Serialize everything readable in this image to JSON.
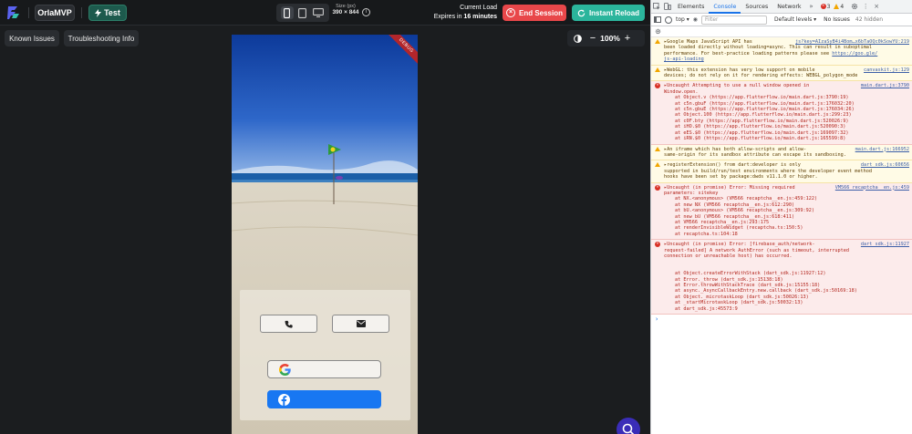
{
  "topbar": {
    "project_name": "OrlaMVP",
    "test_label": "Test",
    "size_label": "Size (px)",
    "size_value": "390 × 844",
    "load_label": "Current Load",
    "expires_prefix": "Expires in",
    "expires_value": "16 minutes",
    "end_session_label": "End Session",
    "instant_reload_label": "Instant Reload"
  },
  "toolbar": {
    "known_issues_label": "Known Issues",
    "troubleshooting_label": "Troubleshooting Info",
    "zoom_minus": "−",
    "zoom_value": "100%",
    "zoom_plus": "+"
  },
  "phone": {
    "debug_banner": "DEBUG"
  },
  "devtools": {
    "tabs": [
      "Elements",
      "Console",
      "Sources",
      "Network"
    ],
    "active_tab": "Console",
    "more_tabs": "»",
    "error_count": "3",
    "warning_count": "4",
    "context": "top",
    "filter_placeholder": "Filter",
    "levels": "Default levels",
    "issues": "No Issues",
    "hidden": "42 hidden",
    "messages": [
      {
        "level": "warn",
        "lines": [
          {
            "text": "▸Google Maps JavaScript API has",
            "src": "js?key=AIzaSyB4i4Bom…x6bTaOQc0kSowYU:219"
          },
          {
            "text": "been loaded directly without loading=async. This can result in suboptimal"
          },
          {
            "text": "performance. For best-practice loading patterns please see",
            "link": "https://goo.gle/"
          },
          {
            "link": "js-api-loading"
          }
        ],
        "stack": []
      },
      {
        "level": "warn",
        "lines": [
          {
            "text": "▸WebGL: this extension has very low support on mobile",
            "src": "canvaskit.js:129"
          },
          {
            "text": "devices; do not rely on it for rendering effects: WEBGL_polygon_mode"
          }
        ],
        "stack": []
      },
      {
        "level": "err",
        "lines": [
          {
            "text": "▸Uncaught Attempting to use a null window opened in",
            "src": "main.dart.js:3790"
          },
          {
            "text": "Window.open."
          }
        ],
        "stack": [
          "at Object.v (https://app.flutterflow.io/main.dart.js:3790:19)",
          "at c5n.gbuF (https://app.flutterflow.io/main.dart.js:176032:20)",
          "at c5n.gbuE (https://app.flutterflow.io/main.dart.js:176034:26)",
          "at Object.100 (https://app.flutterflow.io/main.dart.js:299:23)",
          "at c0F.bty (https://app.flutterflow.io/main.dart.js:520026:9)",
          "at iHO.$0 (https://app.flutterflow.io/main.dart.js:520090:3)",
          "at eES.$0 (https://app.flutterflow.io/main.dart.js:169097:32)",
          "at iRN.$0 (https://app.flutterflow.io/main.dart.js:165599:8)"
        ]
      },
      {
        "level": "warn",
        "lines": [
          {
            "text": "▸An iframe which has both allow-scripts and allow-",
            "src": "main.dart.js:166952"
          },
          {
            "text": "same-origin for its sandbox attribute can escape its sandboxing."
          }
        ],
        "stack": []
      },
      {
        "level": "warn",
        "lines": [
          {
            "text": "▸registerExtension() from dart:developer is only",
            "src": "dart_sdk.js:60656"
          },
          {
            "text": "supported in build/run/test environments where the developer event method"
          },
          {
            "text": "hooks have been set by package:dwds v11.1.0 or higher."
          }
        ],
        "stack": []
      },
      {
        "level": "err",
        "lines": [
          {
            "text": "▸Uncaught (in promise) Error: Missing required",
            "src": "VM566 recaptcha__en.js:459"
          },
          {
            "text": "parameters: sitekey"
          }
        ],
        "stack": [
          "at NX.<anonymous> (VM566 recaptcha__en.js:459:122)",
          "at new NX (VM566 recaptcha__en.js:612:290)",
          "at bU.<anonymous> (VM566 recaptcha__en.js:309:92)",
          "at new bU (VM566 recaptcha__en.js:618:411)",
          "at VM566 recaptcha__en.js:293:175",
          "at renderInvisibleWidget (recaptcha.ts:150:5)",
          "at recaptcha.ts:104:18"
        ]
      },
      {
        "level": "err",
        "lines": [
          {
            "text": "▸Uncaught (in promise) Error: [firebase_auth/network-",
            "src": "dart_sdk.js:11927"
          },
          {
            "text": "request-failed] A network AuthError (such as timeout, interrupted"
          },
          {
            "text": "connection or unreachable host) has occurred."
          },
          {
            "text": " "
          },
          {
            "text": " "
          }
        ],
        "stack": [
          "at Object.createErrorWithStack (dart_sdk.js:11927:12)",
          "at Error._throw (dart_sdk.js:15138:18)",
          "at Error.throwWithStackTrace (dart_sdk.js:15155:18)",
          "at async._AsyncCallbackEntry.new.callback (dart_sdk.js:50169:18)",
          "at Object._microtaskLoop (dart_sdk.js:50026:13)",
          "at _startMicrotaskLoop (dart_sdk.js:50032:13)",
          "at dart_sdk.js:45573:9"
        ]
      }
    ],
    "prompt": "›"
  },
  "icons": {
    "logo": "flutterflow-logo-icon",
    "phone": "phone-icon",
    "email": "envelope-icon",
    "google": "google-icon",
    "facebook": "facebook-icon",
    "chat": "chat-icon"
  },
  "colors": {
    "accent_teal": "#2bb59c",
    "end_red": "#e8474a",
    "facebook_blue": "#1877f2",
    "devtools_blue": "#1a73e8"
  }
}
